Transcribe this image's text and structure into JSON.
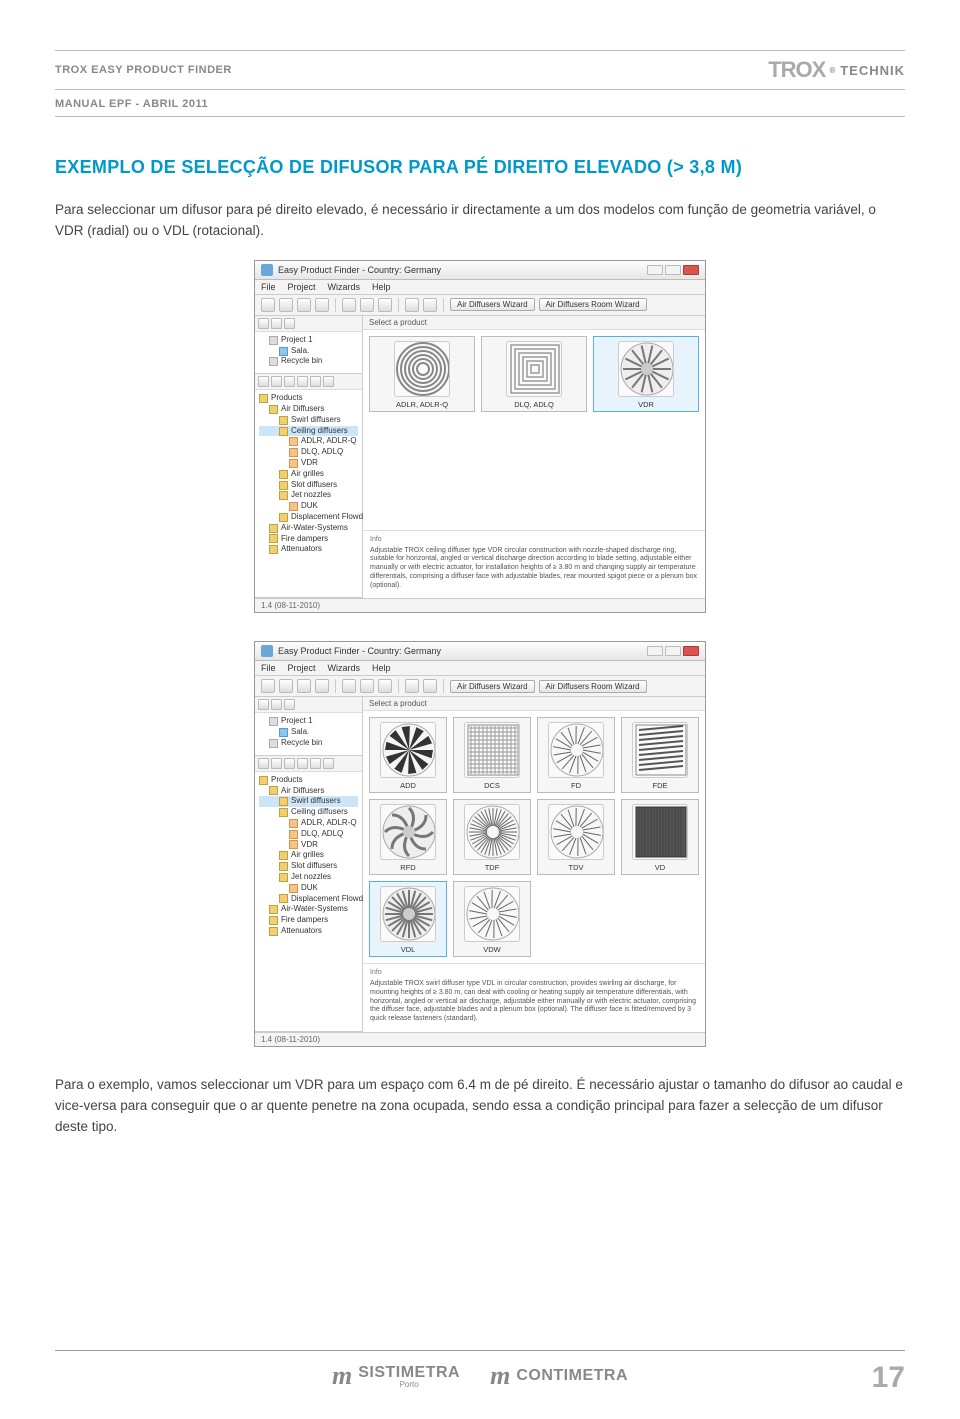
{
  "header": {
    "left": "TROX EASY PRODUCT FINDER",
    "brand": "TROX",
    "brand_suffix": "TECHNIK",
    "sub": "MANUAL EPF - ABRIL 2011"
  },
  "title": "EXEMPLO DE SELECÇÃO DE DIFUSOR PARA PÉ DIREITO ELEVADO (> 3,8 M)",
  "intro": "Para seleccionar um difusor para pé direito elevado, é necessário ir directamente a um dos modelos com função de geometria variável, o VDR (radial) ou o VDL (rotacional).",
  "outro": "Para o exemplo, vamos seleccionar um VDR para um espaço com 6.4 m de pé direito. É necessário ajustar o tamanho do difusor ao caudal e vice-versa para conseguir que o ar quente penetre na zona ocupada, sendo essa a condição principal para fazer a selecção de um difusor deste tipo.",
  "app": {
    "title": "Easy Product Finder - Country: Germany",
    "menus": [
      "File",
      "Project",
      "Wizards",
      "Help"
    ],
    "wizard1": "Air Diffusers Wizard",
    "wizard2": "Air Diffusers Room Wizard",
    "select_label": "Select a product",
    "info_label": "Info",
    "statusbar": "1.4 (08-11-2010)",
    "project_tree": [
      {
        "label": "Project 1",
        "icon": "gray",
        "indent": 10
      },
      {
        "label": "Sala.",
        "icon": "blue",
        "indent": 20
      },
      {
        "label": "Recycle bin",
        "icon": "gray",
        "indent": 10
      }
    ],
    "product_tree": [
      {
        "label": "Products",
        "icon": "yellow",
        "indent": 0
      },
      {
        "label": "Air Diffusers",
        "icon": "yellow",
        "indent": 10
      },
      {
        "label": "Swirl diffusers",
        "icon": "yellow",
        "indent": 20
      },
      {
        "label": "Ceiling diffusers",
        "icon": "yellow",
        "indent": 20,
        "sel": true
      },
      {
        "label": "ADLR, ADLR-Q",
        "icon": "orange",
        "indent": 30
      },
      {
        "label": "DLQ, ADLQ",
        "icon": "orange",
        "indent": 30
      },
      {
        "label": "VDR",
        "icon": "orange",
        "indent": 30
      },
      {
        "label": "Air grilles",
        "icon": "yellow",
        "indent": 20
      },
      {
        "label": "Slot diffusers",
        "icon": "yellow",
        "indent": 20
      },
      {
        "label": "Jet nozzles",
        "icon": "yellow",
        "indent": 20
      },
      {
        "label": "DUK",
        "icon": "orange",
        "indent": 30
      },
      {
        "label": "Displacement Flowdiffusers",
        "icon": "yellow",
        "indent": 20
      },
      {
        "label": "Air-Water-Systems",
        "icon": "yellow",
        "indent": 10
      },
      {
        "label": "Fire dampers",
        "icon": "yellow",
        "indent": 10
      },
      {
        "label": "Attenuators",
        "icon": "yellow",
        "indent": 10
      }
    ]
  },
  "shot1": {
    "products": [
      {
        "label": "ADLR, ADLR-Q",
        "type": "round-rings"
      },
      {
        "label": "DLQ, ADLQ",
        "type": "square-rings"
      },
      {
        "label": "VDR",
        "type": "round-slats",
        "sel": true
      }
    ],
    "info_text": "Adjustable TROX ceiling diffuser type VDR circular construction with nozzle-shaped discharge ring, suitable for horizontal, angled or vertical discharge direction according to blade setting, adjustable either manually or with electric actuator, for installation heights of ≥ 3.80 m and changing supply air temperature differentials, comprising a diffuser face with adjustable blades, rear mounted spigot piece or a plenum box (optional)."
  },
  "shot2": {
    "product_tree": [
      {
        "label": "Products",
        "icon": "yellow",
        "indent": 0
      },
      {
        "label": "Air Diffusers",
        "icon": "yellow",
        "indent": 10
      },
      {
        "label": "Swirl diffusers",
        "icon": "yellow",
        "indent": 20,
        "sel": true
      },
      {
        "label": "Ceiling diffusers",
        "icon": "yellow",
        "indent": 20
      },
      {
        "label": "ADLR, ADLR-Q",
        "icon": "orange",
        "indent": 30
      },
      {
        "label": "DLQ, ADLQ",
        "icon": "orange",
        "indent": 30
      },
      {
        "label": "VDR",
        "icon": "orange",
        "indent": 30
      },
      {
        "label": "Air grilles",
        "icon": "yellow",
        "indent": 20
      },
      {
        "label": "Slot diffusers",
        "icon": "yellow",
        "indent": 20
      },
      {
        "label": "Jet nozzles",
        "icon": "yellow",
        "indent": 20
      },
      {
        "label": "DUK",
        "icon": "orange",
        "indent": 30
      },
      {
        "label": "Displacement Flowdiffusers",
        "icon": "yellow",
        "indent": 20
      },
      {
        "label": "Air-Water-Systems",
        "icon": "yellow",
        "indent": 10
      },
      {
        "label": "Fire dampers",
        "icon": "yellow",
        "indent": 10
      },
      {
        "label": "Attenuators",
        "icon": "yellow",
        "indent": 10
      }
    ],
    "products": [
      {
        "label": "ADD",
        "type": "fan-black"
      },
      {
        "label": "DCS",
        "type": "square-grille"
      },
      {
        "label": "FD",
        "type": "swirl-thin"
      },
      {
        "label": "FDE",
        "type": "square-slats"
      },
      {
        "label": "RFD",
        "type": "round-swirl"
      },
      {
        "label": "TDF",
        "type": "sun-thin"
      },
      {
        "label": "TDV",
        "type": "swirl-thin"
      },
      {
        "label": "VD",
        "type": "square-dark"
      },
      {
        "label": "VDL",
        "type": "round-slats-dense",
        "sel": true
      },
      {
        "label": "VDW",
        "type": "swirl-thin"
      }
    ],
    "info_text": "Adjustable TROX swirl diffuser type VDL in circular construction, provides swirling air discharge, for mounting heights of ≥ 3.80 m, can deal with cooling or heating supply air temperature differentials, with horizontal, angled or vertical air discharge, adjustable either manually or with electric actuator, comprising the diffuser face, adjustable blades and a plenum box (optional). The diffuser face is fitted/removed by 3 quick release fasteners (standard)."
  },
  "footer": {
    "brand1": "SISTIMETRA",
    "brand1_sub": "Porto",
    "brand2": "CONTIMETRA",
    "page": "17"
  }
}
